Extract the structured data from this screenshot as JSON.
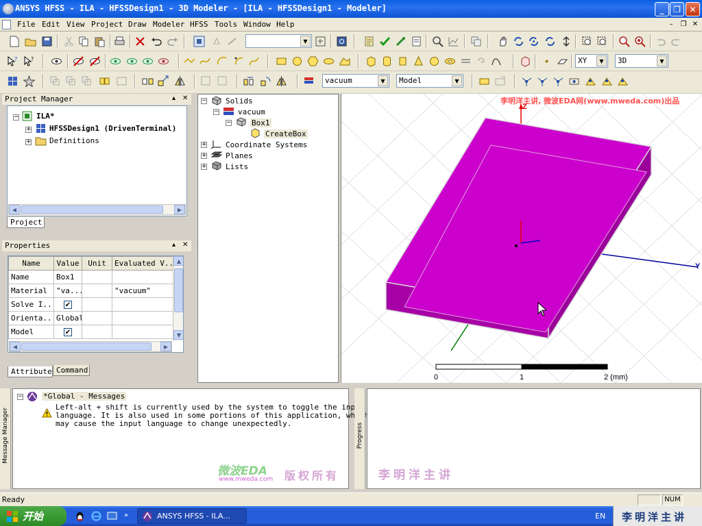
{
  "title": "ANSYS HFSS - ILA - HFSSDesign1 - 3D Modeler - [ILA - HFSSDesign1 - Modeler]",
  "window_buttons": {
    "minimize": "_",
    "restore": "❐",
    "close": "✕"
  },
  "menu": [
    "File",
    "Edit",
    "View",
    "Project",
    "Draw",
    "Modeler",
    "HFSS",
    "Tools",
    "Window",
    "Help"
  ],
  "mdi_buttons": {
    "minimize": "–",
    "restore": "❐",
    "close": "✕"
  },
  "toolbar": {
    "view_combo": "",
    "plane_combo": "XY",
    "mode_combo": "3D",
    "material_combo": "vacuum",
    "model_combo": "Model"
  },
  "project_manager": {
    "title": "Project Manager",
    "root": "ILA*",
    "design": "HFSSDesign1 (DrivenTerminal)",
    "definitions": "Definitions",
    "tab": "Project"
  },
  "history_tree": {
    "solids": "Solids",
    "vacuum": "vacuum",
    "box": "Box1",
    "command": "CreateBox",
    "coordinate_systems": "Coordinate Systems",
    "planes": "Planes",
    "lists": "Lists"
  },
  "properties": {
    "title": "Properties",
    "columns": [
      "Name",
      "Value",
      "Unit",
      "Evaluated V..."
    ],
    "rows": [
      {
        "name": "Name",
        "value": "Box1",
        "unit": "",
        "evaluated": ""
      },
      {
        "name": "Material",
        "value": "\"va...",
        "unit": "",
        "evaluated": "\"vacuum\""
      },
      {
        "name": "Solve I...",
        "value": "",
        "unit": "",
        "evaluated": ""
      },
      {
        "name": "Orienta...",
        "value": "Global",
        "unit": "",
        "evaluated": ""
      },
      {
        "name": "Model",
        "value": "",
        "unit": "",
        "evaluated": ""
      }
    ],
    "tabs": [
      "Attribute",
      "Command"
    ]
  },
  "viewport": {
    "watermark": "李明洋主讲, 微波EDA网(www.mweda.com)出品",
    "axis_z": "Z",
    "axis_y": "Y",
    "scale_labels": [
      "0",
      "1",
      "2 (mm)"
    ],
    "colors": {
      "box": "#cc00cc",
      "axis_z": "#e00000",
      "axis_y": "#0000a0",
      "axis_x": "#008000"
    }
  },
  "messages": {
    "header": "*Global - Messages",
    "lines": [
      "Left-alt + shift is currently used by the system to toggle the input",
      "language. It is also used in some portions of this application, which",
      "may cause the input language to change unexpectedly."
    ],
    "side_label": "Message Manager",
    "watermark_eda": "微波EDA",
    "watermark_url": "www.mweda.com",
    "watermark_rights": "版权所有"
  },
  "progress": {
    "side_label": "Progress",
    "watermark": "李明洋主讲"
  },
  "status": {
    "text": "Ready",
    "num": "NUM"
  },
  "taskbar": {
    "start": "开始",
    "task": "ANSYS HFSS - ILA...",
    "lang": "EN",
    "tray_text": "李明洋主讲"
  }
}
